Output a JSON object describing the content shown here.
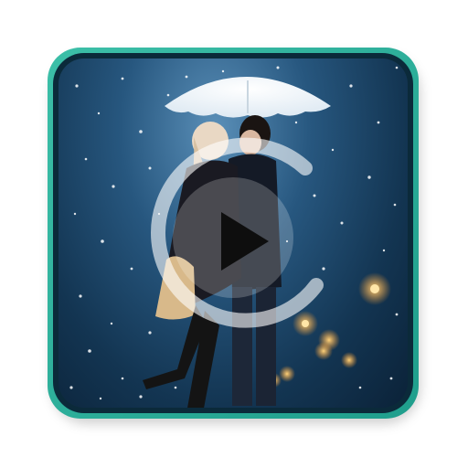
{
  "icon": {
    "name": "video-player-app-icon",
    "frame_color": "#2bb09c",
    "ring_color": "#0b2a3a",
    "play_overlay_color": "#ffffff",
    "scene": "couple-kissing-under-umbrella-in-rain"
  }
}
